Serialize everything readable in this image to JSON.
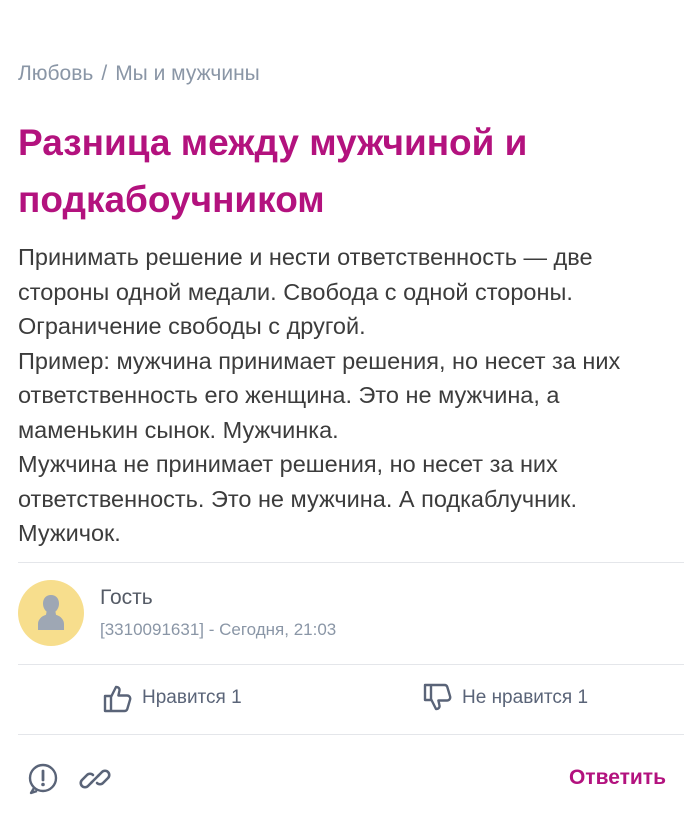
{
  "breadcrumb": {
    "items": [
      "Любовь",
      "Мы и мужчины"
    ],
    "separator": "/"
  },
  "article": {
    "title": "Разница между мужчиной и подкабоучником",
    "paragraphs": [
      "Принимать решение и нести ответственность — две стороны одной медали. Свобода с одной стороны. Ограничение свободы с другой.",
      "Пример: мужчина принимает решения, но несет за них ответственность его женщина. Это не мужчина, а маменькин сынок. Мужчинка.",
      "Мужчина не принимает решения, но несет за них ответственность. Это не мужчина. А подкаблучник. Мужичок."
    ]
  },
  "author": {
    "name": "Гость",
    "meta": "[3310091631] - Сегодня, 21:03",
    "avatar_icon": "user-silhouette-icon"
  },
  "reactions": {
    "like_label": "Нравится 1",
    "dislike_label": "Не нравится 1",
    "like_icon": "thumbs-up-icon",
    "dislike_icon": "thumbs-down-icon"
  },
  "footer": {
    "report_icon": "exclamation-circle-icon",
    "link_icon": "chain-link-icon",
    "reply_label": "Ответить"
  },
  "colors": {
    "accent": "#b3127e",
    "muted": "#8a96a6",
    "avatar_bg": "#f7de8d"
  }
}
